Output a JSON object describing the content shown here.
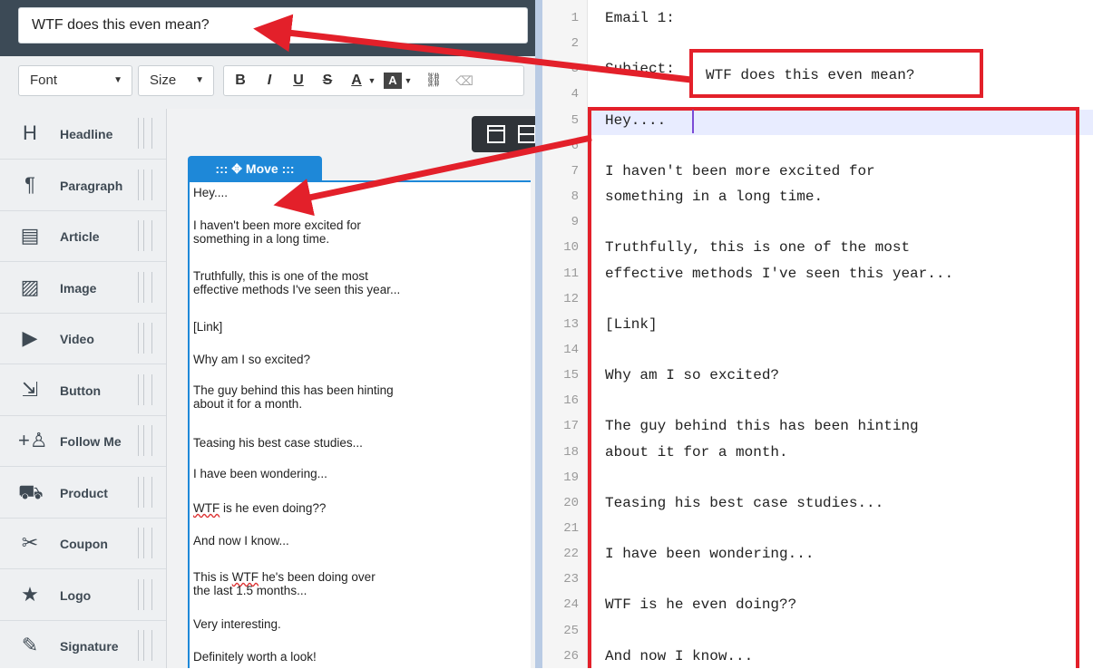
{
  "subject": {
    "value": "WTF does this even mean?"
  },
  "toolbar": {
    "font_label": "Font",
    "size_label": "Size",
    "buttons": [
      "B",
      "I",
      "U",
      "S",
      "A",
      "A",
      "⛓",
      "⌫"
    ]
  },
  "blocks": [
    {
      "label": "Headline",
      "icon": "headline-icon",
      "glyph": "H"
    },
    {
      "label": "Paragraph",
      "icon": "paragraph-icon",
      "glyph": "¶"
    },
    {
      "label": "Article",
      "icon": "article-icon",
      "glyph": "▤"
    },
    {
      "label": "Image",
      "icon": "image-icon",
      "glyph": "▨"
    },
    {
      "label": "Video",
      "icon": "video-icon",
      "glyph": "▶"
    },
    {
      "label": "Button",
      "icon": "button-icon",
      "glyph": "⇲"
    },
    {
      "label": "Follow Me",
      "icon": "follow-me-icon",
      "glyph": "+♙"
    },
    {
      "label": "Product",
      "icon": "product-icon",
      "glyph": "⛟"
    },
    {
      "label": "Coupon",
      "icon": "coupon-icon",
      "glyph": "✂"
    },
    {
      "label": "Logo",
      "icon": "logo-icon",
      "glyph": "★"
    },
    {
      "label": "Signature",
      "icon": "signature-icon",
      "glyph": "✎"
    }
  ],
  "move_tab": {
    "label": "::: ✥ Move :::"
  },
  "editor_paragraphs": [
    [
      "Hey...."
    ],
    [
      "I haven't been more excited for",
      "something in a long time."
    ],
    [
      "Truthfully, this is one of the most",
      "effective methods I've seen this year..."
    ],
    [
      "[Link]"
    ],
    [
      "Why am I so excited?"
    ],
    [
      "The guy behind this has been hinting",
      "about it for a month."
    ],
    [
      "Teasing his best case studies..."
    ],
    [
      "I have been wondering..."
    ],
    [
      "WTF is he even doing??"
    ],
    [
      "And now I know..."
    ],
    [
      "This is WTF he's been doing over",
      "the last 1.5 months..."
    ],
    [
      "Very interesting."
    ],
    [
      "Definitely worth a look!"
    ]
  ],
  "code_lines": [
    {
      "n": "1",
      "text": "Email 1:"
    },
    {
      "n": "2",
      "text": ""
    },
    {
      "n": "3",
      "text": "Subject:"
    },
    {
      "n": "4",
      "text": ""
    },
    {
      "n": "5",
      "text": "Hey...."
    },
    {
      "n": "6",
      "text": ""
    },
    {
      "n": "7",
      "text": "I haven't been more excited for"
    },
    {
      "n": "8",
      "text": "something in a long time."
    },
    {
      "n": "9",
      "text": ""
    },
    {
      "n": "10",
      "text": "Truthfully, this is one of the most"
    },
    {
      "n": "11",
      "text": "effective methods I've seen this year..."
    },
    {
      "n": "12",
      "text": ""
    },
    {
      "n": "13",
      "text": "[Link]"
    },
    {
      "n": "14",
      "text": ""
    },
    {
      "n": "15",
      "text": "Why am I so excited?"
    },
    {
      "n": "16",
      "text": ""
    },
    {
      "n": "17",
      "text": "The guy behind this has been hinting"
    },
    {
      "n": "18",
      "text": "about it for a month."
    },
    {
      "n": "19",
      "text": ""
    },
    {
      "n": "20",
      "text": "Teasing his best case studies..."
    },
    {
      "n": "21",
      "text": ""
    },
    {
      "n": "22",
      "text": "I have been wondering..."
    },
    {
      "n": "23",
      "text": ""
    },
    {
      "n": "24",
      "text": "WTF is he even doing??"
    },
    {
      "n": "25",
      "text": ""
    },
    {
      "n": "26",
      "text": "And now I know..."
    }
  ],
  "callout": {
    "subject_text": "WTF does this even mean?"
  },
  "colors": {
    "callout_red": "#e3202a",
    "accent_blue": "#1e88d8"
  }
}
